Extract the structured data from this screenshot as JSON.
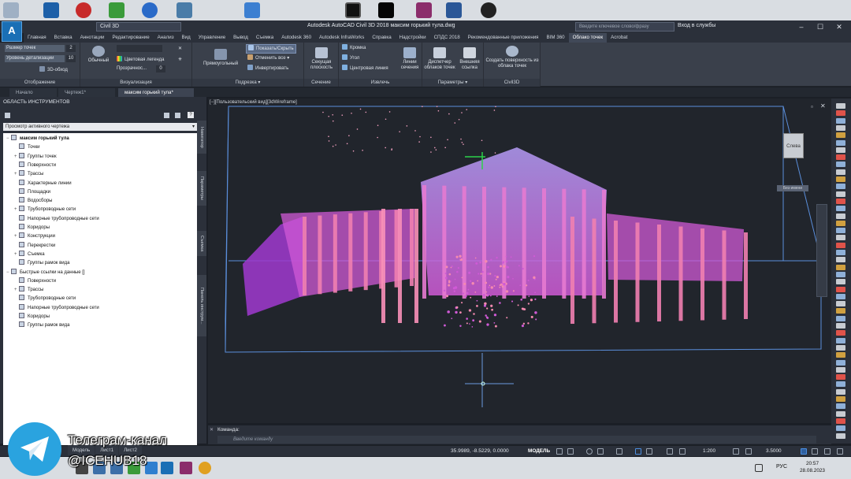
{
  "app": {
    "workspace": "Civil 3D",
    "title": "Autodesk AutoCAD Civil 3D 2018     максим горький тула.dwg",
    "search_placeholder": "Введите ключевое слово/фразу",
    "login": "Вход в службы",
    "accent": "#1a6fb5"
  },
  "ribbon_tabs": [
    "Главная",
    "Вставка",
    "Аннотации",
    "Редактирование",
    "Анализ",
    "Вид",
    "Управление",
    "Вывод",
    "Съемка",
    "Autodesk 360",
    "Autodesk InfraWorks",
    "Справка",
    "Надстройки",
    "СПДС 2018",
    "Рекомендованные приложения",
    "BIM 360",
    "Облако точек",
    "Acrobat"
  ],
  "ribbon_active_tab": "Облако точек",
  "ribbon": {
    "display": {
      "label": "Отображение",
      "point_size_label": "Размер точек",
      "point_size_value": "2",
      "detail_label": "Уровень детализации",
      "detail_value": "10",
      "orbit": "3D-обход"
    },
    "visualization": {
      "label": "Визуализация",
      "normal": "Обычный",
      "legend": "Цветовая легенда",
      "transparency": "Прозрачнос...",
      "transparency_value": "0"
    },
    "cropping": {
      "label": "Подрезка",
      "rect": "Прямоугольный",
      "show_hide": "Показать/Скрыть",
      "undo_all": "Отменить все",
      "invert": "Инвертировать"
    },
    "section": {
      "label": "Сечение",
      "plane": "Секущая плоскость"
    },
    "extract": {
      "label": "Извлечь",
      "edge": "Кромка",
      "corner": "Угол",
      "centerline": "Центровая линия",
      "section_lines": "Линии сечения"
    },
    "options": {
      "label": "Параметры",
      "manager": "Диспетчер облаков точек",
      "external": "Внешняя ссылка"
    },
    "civil3d": {
      "label": "Civil3D",
      "create_surface": "Создать поверхность из облака точек"
    }
  },
  "doc_tabs": [
    "Начало",
    "Чертеж1*",
    "максим горький тула*"
  ],
  "toolspace": {
    "title": "ОБЛАСТЬ ИНСТРУМЕНТОВ",
    "view_select": "Просмотр активного чертежа",
    "tree": [
      {
        "label": "максим горький тула",
        "level": 0,
        "bold": true,
        "exp": "−"
      },
      {
        "label": "Точки",
        "level": 1,
        "exp": ""
      },
      {
        "label": "Группы точек",
        "level": 1,
        "exp": "+"
      },
      {
        "label": "Поверхности",
        "level": 1,
        "exp": ""
      },
      {
        "label": "Трассы",
        "level": 1,
        "exp": "+"
      },
      {
        "label": "Характерные линии",
        "level": 1,
        "exp": ""
      },
      {
        "label": "Площадки",
        "level": 1,
        "exp": ""
      },
      {
        "label": "Водосборы",
        "level": 1,
        "exp": ""
      },
      {
        "label": "Трубопроводные сети",
        "level": 1,
        "exp": "+"
      },
      {
        "label": "Напорные трубопроводные сети",
        "level": 1,
        "exp": ""
      },
      {
        "label": "Коридоры",
        "level": 1,
        "exp": ""
      },
      {
        "label": "Конструкции",
        "level": 1,
        "exp": "+"
      },
      {
        "label": "Перекрестки",
        "level": 1,
        "exp": ""
      },
      {
        "label": "Съемка",
        "level": 1,
        "exp": "+"
      },
      {
        "label": "Группы рамок вида",
        "level": 1,
        "exp": ""
      },
      {
        "label": "Быстрые ссылки на данные []",
        "level": 0,
        "exp": "−"
      },
      {
        "label": "Поверхности",
        "level": 1,
        "exp": ""
      },
      {
        "label": "Трассы",
        "level": 1,
        "exp": "+"
      },
      {
        "label": "Трубопроводные сети",
        "level": 1,
        "exp": ""
      },
      {
        "label": "Напорные трубопроводные сети",
        "level": 1,
        "exp": ""
      },
      {
        "label": "Коридоры",
        "level": 1,
        "exp": ""
      },
      {
        "label": "Группы рамок вида",
        "level": 1,
        "exp": ""
      }
    ],
    "side_tabs": [
      "Навигатор",
      "Параметры",
      "Съемка",
      "Панель инструм..."
    ]
  },
  "viewport": {
    "label": "[−][Пользовательский вид][3dWireframe]",
    "viewcube_face": "Слева",
    "wcs_label": "Без имени"
  },
  "command": {
    "label": "Команда:",
    "placeholder": "Введите команду"
  },
  "layout_tabs": [
    "Модель",
    "Лист1",
    "Лист2"
  ],
  "status": {
    "coords": "35.9989, -8.5229, 0.0000",
    "model": "МОДЕЛЬ",
    "scale": "1:200",
    "value": "3.5000"
  },
  "taskbar": {
    "lang": "РУС",
    "time": "20:57",
    "date": "28.08.2023"
  },
  "overlay": {
    "line1": "Телеграм-канал",
    "line2": "@ICEHUB18"
  }
}
